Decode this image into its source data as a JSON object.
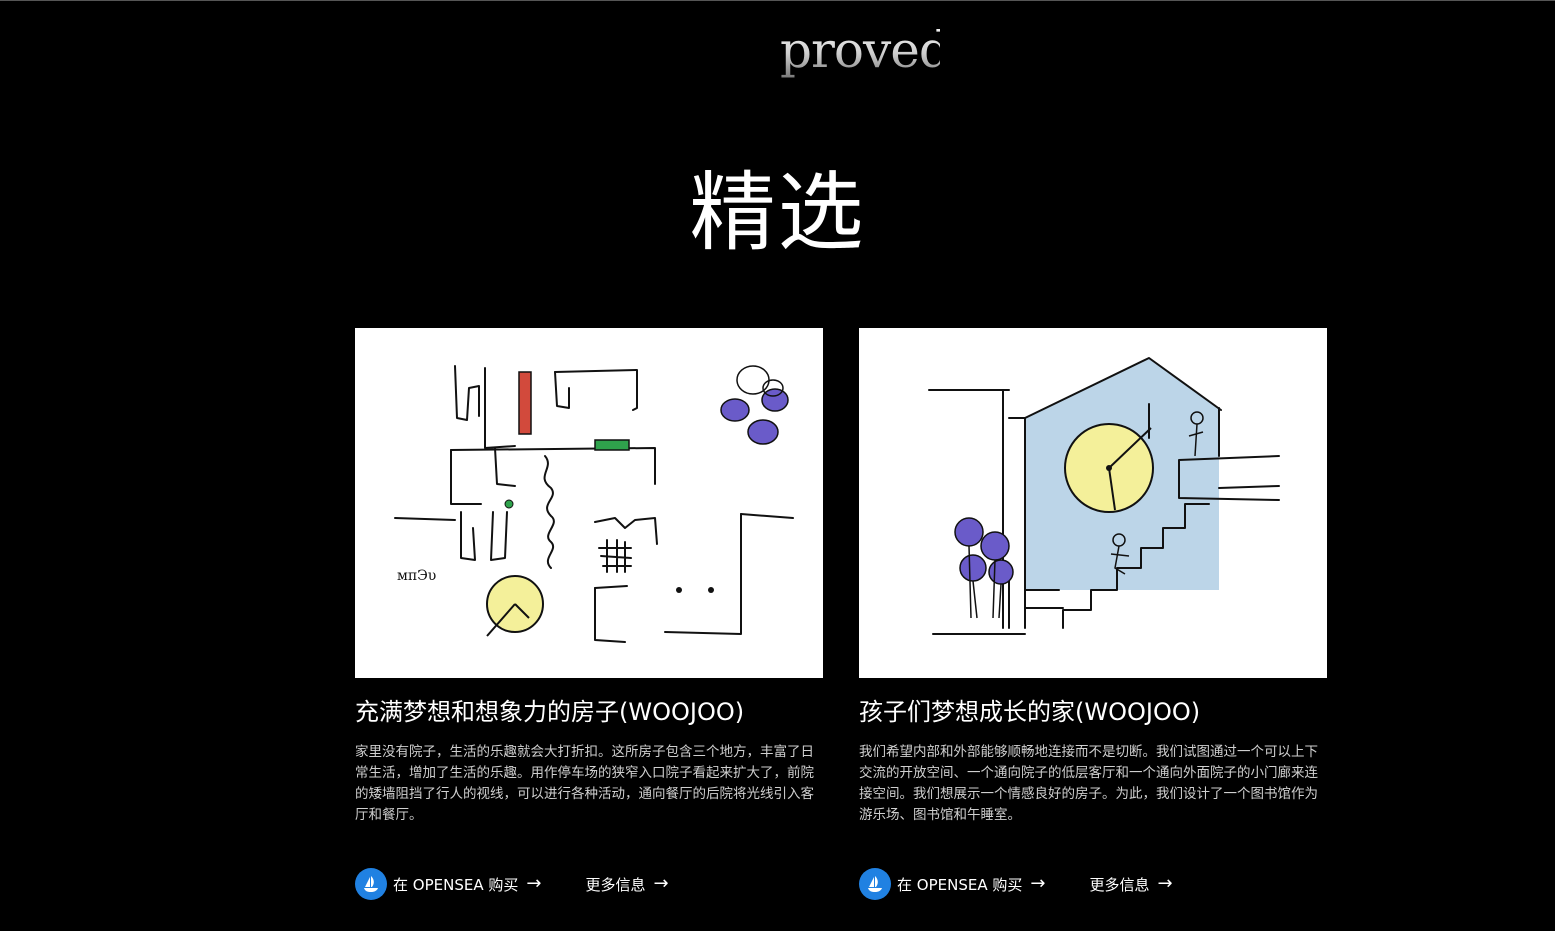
{
  "header": {
    "logo_text": "proved"
  },
  "featured": {
    "title": "精选",
    "cards": [
      {
        "title": "充满梦想和想象力的房子(WOOJOO)",
        "description": "家里没有院子，生活的乐趣就会大打折扣。这所房子包含三个地方，丰富了日常生活，增加了生活的乐趣。用作停车场的狭窄入口院子看起来扩大了，前院的矮墙阻挡了行人的视线，可以进行各种活动，通向餐厅的后院将光线引入客厅和餐厅。",
        "sketch_label": "мπЭυ",
        "buy_label": "在 OPENSEA 购买",
        "more_label": "更多信息"
      },
      {
        "title": "孩子们梦想成长的家(WOOJOO)",
        "description": "我们希望内部和外部能够顺畅地连接而不是切断。我们试图通过一个可以上下交流的开放空间、一个通向院子的低层客厅和一个通向外面院子的小门廊来连接空间。我们想展示一个情感良好的房子。为此，我们设计了一个图书馆作为游乐场、图书馆和午睡室。",
        "buy_label": "在 OPENSEA 购买",
        "more_label": "更多信息"
      }
    ]
  },
  "colors": {
    "background": "#000000",
    "opensea_blue": "#2081e2",
    "text": "#ffffff",
    "body_text": "#cfcfcf"
  },
  "icons": {
    "opensea": "opensea-ship-icon",
    "arrow": "arrow-right-icon"
  }
}
